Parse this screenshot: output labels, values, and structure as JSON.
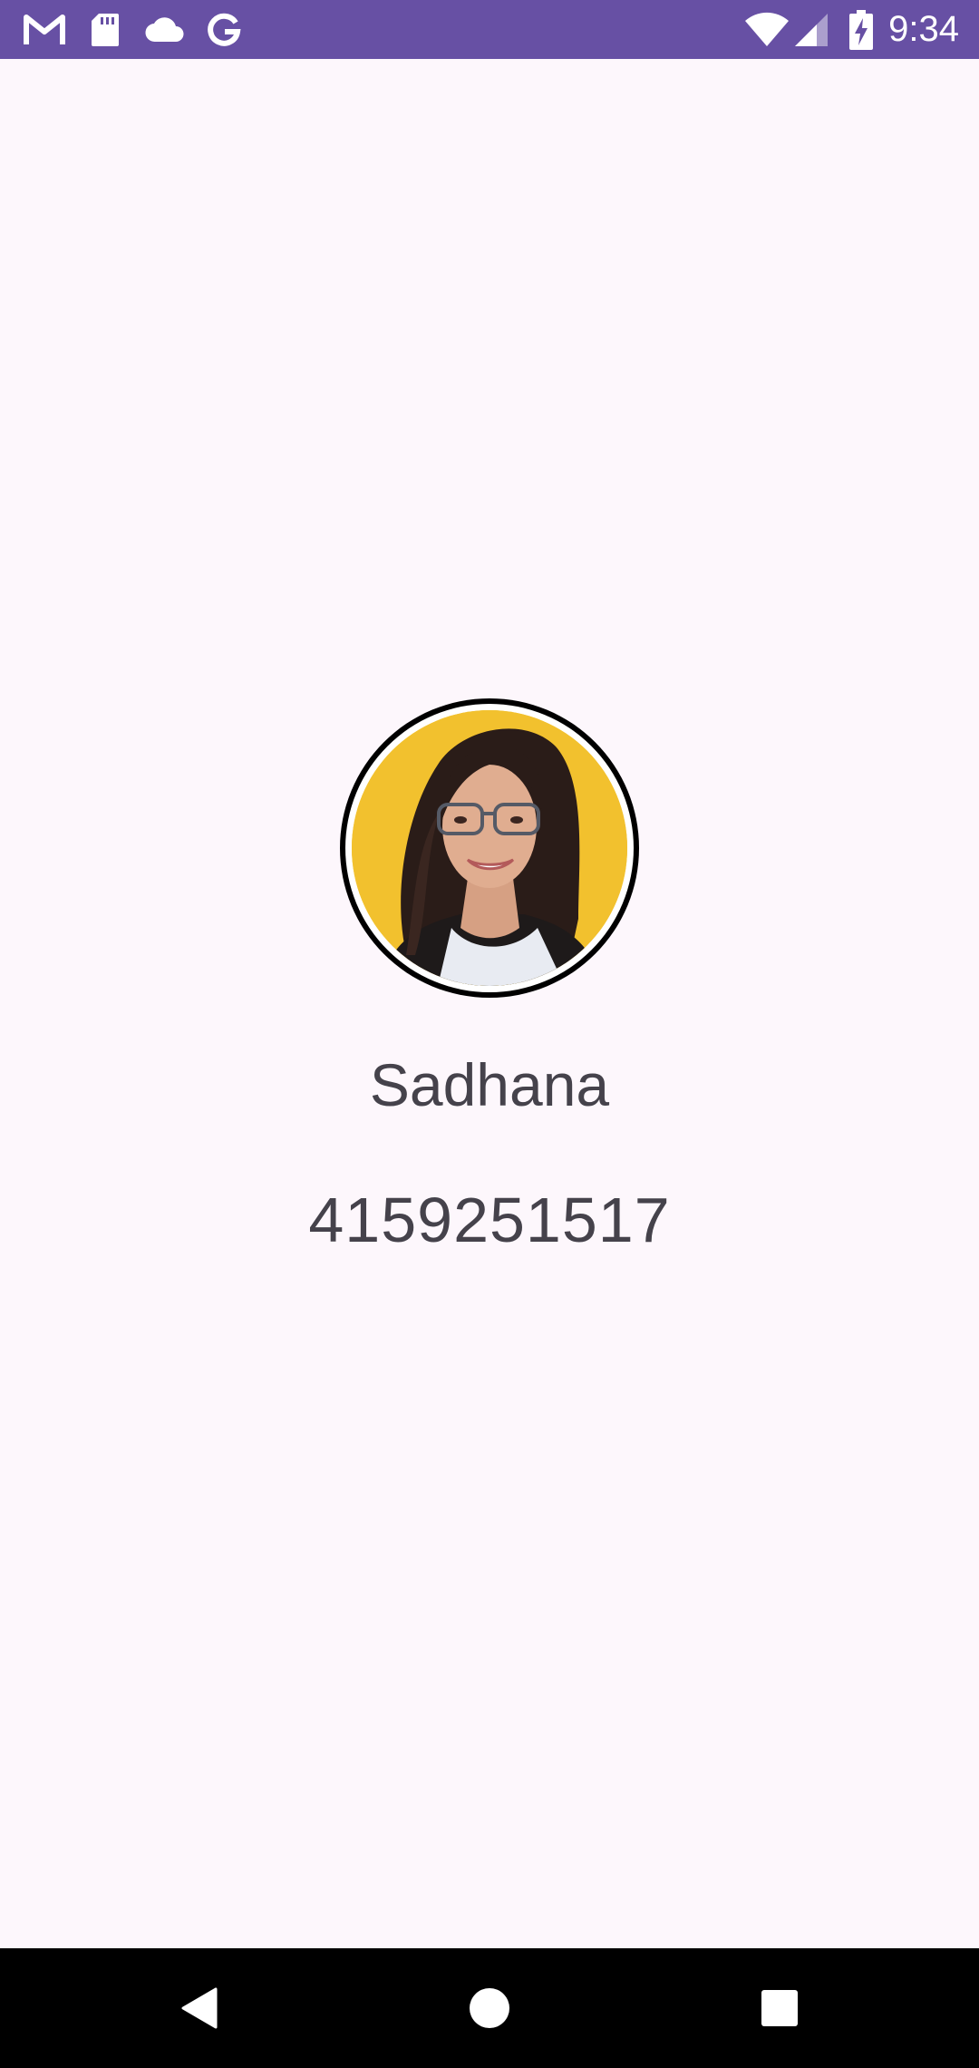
{
  "status_bar": {
    "time": "9:34",
    "background": "#6750a4",
    "left_icons": [
      "gmail-icon",
      "sd-card-icon",
      "cloud-icon",
      "google-icon"
    ],
    "right_icons": [
      "wifi-icon",
      "cell-signal-icon",
      "battery-charging-icon"
    ]
  },
  "contact": {
    "name": "Sadhana",
    "phone": "4159251517"
  },
  "nav_bar": {
    "buttons": [
      "back-icon",
      "home-icon",
      "recents-icon"
    ]
  },
  "colors": {
    "background": "#fdf7fc",
    "text": "#45424b",
    "avatar_bg": "#f2c12e",
    "avatar_ring": "#000000"
  }
}
